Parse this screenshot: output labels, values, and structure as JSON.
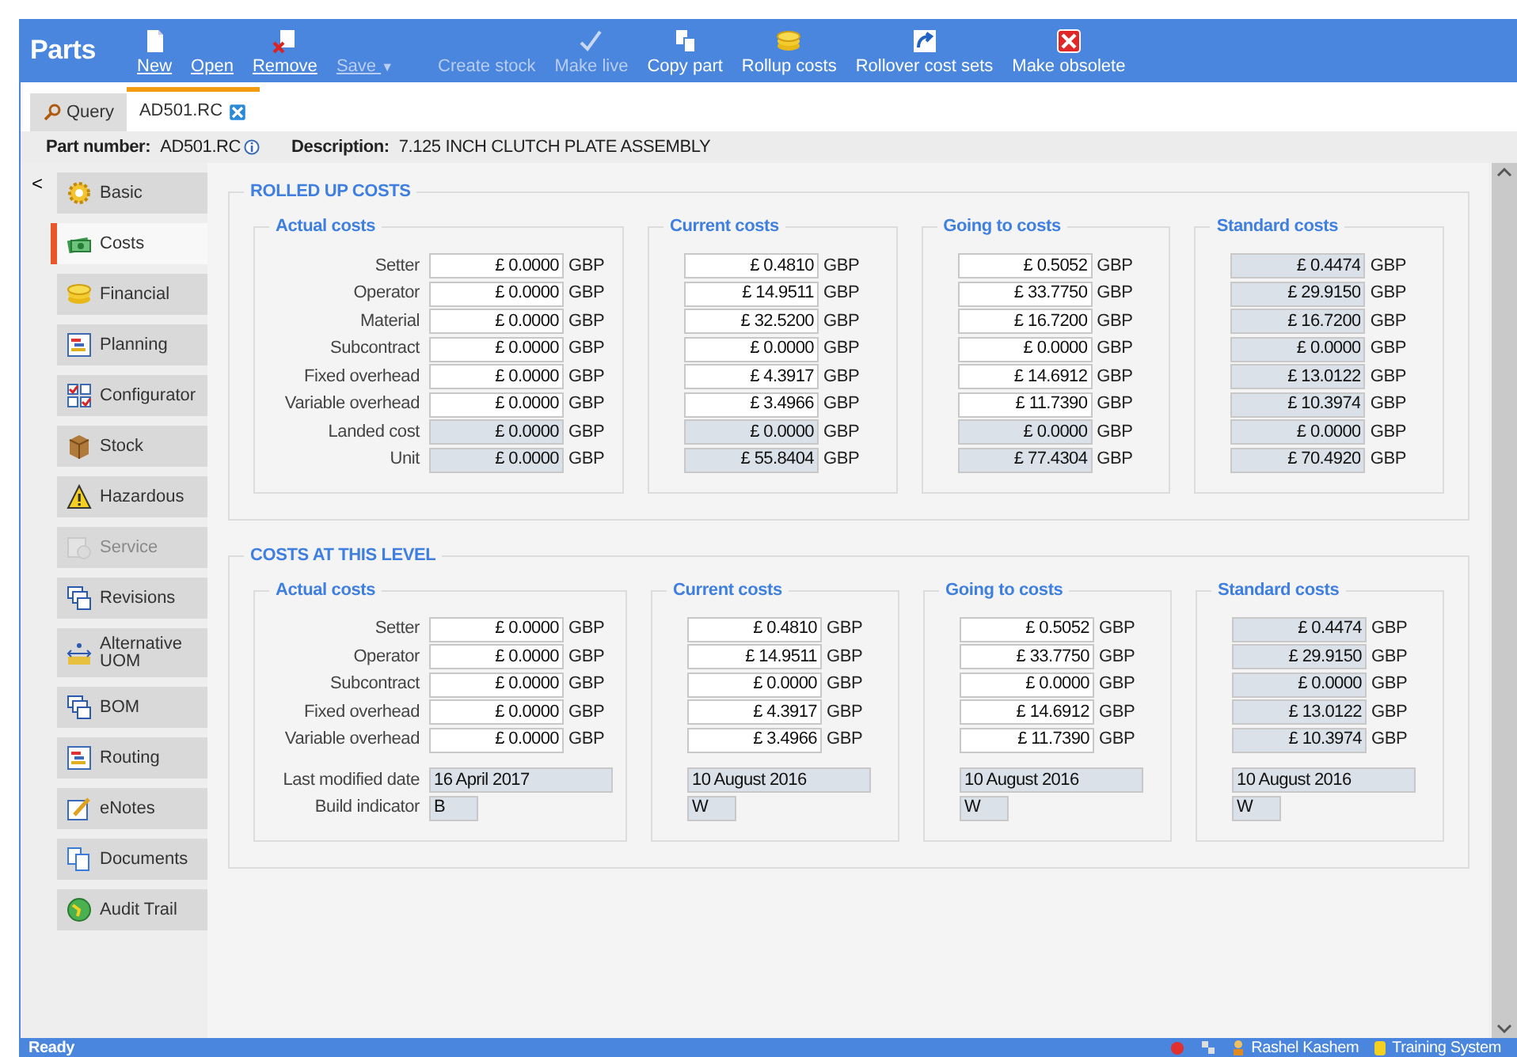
{
  "app": {
    "title": "Parts"
  },
  "toolbar": [
    {
      "label": "New",
      "disabled": false,
      "underlined": true
    },
    {
      "label": "Open",
      "disabled": false,
      "underlined": true
    },
    {
      "label": "Remove",
      "disabled": false,
      "underlined": true
    },
    {
      "label": "Save",
      "disabled": true,
      "underlined": true,
      "dropdown": "▼"
    },
    {
      "label": "Create stock",
      "disabled": true,
      "underlined": false
    },
    {
      "label": "Make live",
      "disabled": true,
      "underlined": false
    },
    {
      "label": "Copy part",
      "disabled": false,
      "underlined": false
    },
    {
      "label": "Rollup costs",
      "disabled": false,
      "underlined": false
    },
    {
      "label": "Rollover cost sets",
      "disabled": false,
      "underlined": false
    },
    {
      "label": "Make obsolete",
      "disabled": false,
      "underlined": false
    }
  ],
  "tabs": [
    {
      "label": "Query",
      "selected": false,
      "closable": false
    },
    {
      "label": "AD501.RC",
      "selected": true,
      "closable": true
    }
  ],
  "part": {
    "number_label": "Part number:",
    "number": "AD501.RC",
    "description_label": "Description:",
    "description": "7.125 INCH CLUTCH PLATE ASSEMBLY"
  },
  "sidebar": {
    "collapse": "<",
    "items": [
      {
        "label": "Basic",
        "selected": false,
        "disabled": false
      },
      {
        "label": "Costs",
        "selected": true,
        "disabled": false
      },
      {
        "label": "Financial",
        "selected": false,
        "disabled": false
      },
      {
        "label": "Planning",
        "selected": false,
        "disabled": false
      },
      {
        "label": "Configurator",
        "selected": false,
        "disabled": false
      },
      {
        "label": "Stock",
        "selected": false,
        "disabled": false
      },
      {
        "label": "Hazardous",
        "selected": false,
        "disabled": false
      },
      {
        "label": "Service",
        "selected": false,
        "disabled": true
      },
      {
        "label": "Revisions",
        "selected": false,
        "disabled": false
      },
      {
        "label": "Alternative UOM",
        "selected": false,
        "disabled": false
      },
      {
        "label": "BOM",
        "selected": false,
        "disabled": false
      },
      {
        "label": "Routing",
        "selected": false,
        "disabled": false
      },
      {
        "label": "eNotes",
        "selected": false,
        "disabled": false
      },
      {
        "label": "Documents",
        "selected": false,
        "disabled": false
      },
      {
        "label": "Audit Trail",
        "selected": false,
        "disabled": false
      }
    ]
  },
  "sections": [
    {
      "title": "ROLLED UP COSTS",
      "groups": [
        {
          "title": "Actual costs",
          "rows": [
            {
              "label": "Setter",
              "kind": "money",
              "value": "£ 0.0000",
              "unit": "GBP",
              "readonly": false
            },
            {
              "label": "Operator",
              "kind": "money",
              "value": "£ 0.0000",
              "unit": "GBP",
              "readonly": false
            },
            {
              "label": "Material",
              "kind": "money",
              "value": "£ 0.0000",
              "unit": "GBP",
              "readonly": false
            },
            {
              "label": "Subcontract",
              "kind": "money",
              "value": "£ 0.0000",
              "unit": "GBP",
              "readonly": false
            },
            {
              "label": "Fixed overhead",
              "kind": "money",
              "value": "£ 0.0000",
              "unit": "GBP",
              "readonly": false
            },
            {
              "label": "Variable overhead",
              "kind": "money",
              "value": "£ 0.0000",
              "unit": "GBP",
              "readonly": false
            },
            {
              "label": "Landed cost",
              "kind": "money",
              "value": "£ 0.0000",
              "unit": "GBP",
              "readonly": true
            },
            {
              "label": "Unit",
              "kind": "money",
              "value": "£ 0.0000",
              "unit": "GBP",
              "readonly": true
            }
          ]
        },
        {
          "title": "Current costs",
          "rows": [
            {
              "kind": "money",
              "value": "£ 0.4810",
              "unit": "GBP",
              "readonly": false
            },
            {
              "kind": "money",
              "value": "£ 14.9511",
              "unit": "GBP",
              "readonly": false
            },
            {
              "kind": "money",
              "value": "£ 32.5200",
              "unit": "GBP",
              "readonly": false
            },
            {
              "kind": "money",
              "value": "£ 0.0000",
              "unit": "GBP",
              "readonly": false
            },
            {
              "kind": "money",
              "value": "£ 4.3917",
              "unit": "GBP",
              "readonly": false
            },
            {
              "kind": "money",
              "value": "£ 3.4966",
              "unit": "GBP",
              "readonly": false
            },
            {
              "kind": "money",
              "value": "£ 0.0000",
              "unit": "GBP",
              "readonly": true
            },
            {
              "kind": "money",
              "value": "£ 55.8404",
              "unit": "GBP",
              "readonly": true
            }
          ]
        },
        {
          "title": "Going to costs",
          "rows": [
            {
              "kind": "money",
              "value": "£ 0.5052",
              "unit": "GBP",
              "readonly": false
            },
            {
              "kind": "money",
              "value": "£ 33.7750",
              "unit": "GBP",
              "readonly": false
            },
            {
              "kind": "money",
              "value": "£ 16.7200",
              "unit": "GBP",
              "readonly": false
            },
            {
              "kind": "money",
              "value": "£ 0.0000",
              "unit": "GBP",
              "readonly": false
            },
            {
              "kind": "money",
              "value": "£ 14.6912",
              "unit": "GBP",
              "readonly": false
            },
            {
              "kind": "money",
              "value": "£ 11.7390",
              "unit": "GBP",
              "readonly": false
            },
            {
              "kind": "money",
              "value": "£ 0.0000",
              "unit": "GBP",
              "readonly": true
            },
            {
              "kind": "money",
              "value": "£ 77.4304",
              "unit": "GBP",
              "readonly": true
            }
          ]
        },
        {
          "title": "Standard costs",
          "rows": [
            {
              "kind": "money",
              "value": "£ 0.4474",
              "unit": "GBP",
              "readonly": true
            },
            {
              "kind": "money",
              "value": "£ 29.9150",
              "unit": "GBP",
              "readonly": true
            },
            {
              "kind": "money",
              "value": "£ 16.7200",
              "unit": "GBP",
              "readonly": true
            },
            {
              "kind": "money",
              "value": "£ 0.0000",
              "unit": "GBP",
              "readonly": true
            },
            {
              "kind": "money",
              "value": "£ 13.0122",
              "unit": "GBP",
              "readonly": true
            },
            {
              "kind": "money",
              "value": "£ 10.3974",
              "unit": "GBP",
              "readonly": true
            },
            {
              "kind": "money",
              "value": "£ 0.0000",
              "unit": "GBP",
              "readonly": true
            },
            {
              "kind": "money",
              "value": "£ 70.4920",
              "unit": "GBP",
              "readonly": true
            }
          ]
        }
      ]
    },
    {
      "title": "COSTS AT THIS LEVEL",
      "groups": [
        {
          "title": "Actual costs",
          "rows": [
            {
              "label": "Setter",
              "kind": "money",
              "value": "£ 0.0000",
              "unit": "GBP",
              "readonly": false
            },
            {
              "label": "Operator",
              "kind": "money",
              "value": "£ 0.0000",
              "unit": "GBP",
              "readonly": false
            },
            {
              "label": "Subcontract",
              "kind": "money",
              "value": "£ 0.0000",
              "unit": "GBP",
              "readonly": false
            },
            {
              "label": "Fixed overhead",
              "kind": "money",
              "value": "£ 0.0000",
              "unit": "GBP",
              "readonly": false
            },
            {
              "label": "Variable overhead",
              "kind": "money",
              "value": "£ 0.0000",
              "unit": "GBP",
              "readonly": false
            },
            {
              "label": "Last modified date",
              "kind": "date",
              "value": "16 April 2017",
              "readonly": true
            },
            {
              "label": "Build indicator",
              "kind": "code",
              "value": "B",
              "readonly": true
            }
          ]
        },
        {
          "title": "Current costs",
          "rows": [
            {
              "kind": "money",
              "value": "£ 0.4810",
              "unit": "GBP",
              "readonly": false
            },
            {
              "kind": "money",
              "value": "£ 14.9511",
              "unit": "GBP",
              "readonly": false
            },
            {
              "kind": "money",
              "value": "£ 0.0000",
              "unit": "GBP",
              "readonly": false
            },
            {
              "kind": "money",
              "value": "£ 4.3917",
              "unit": "GBP",
              "readonly": false
            },
            {
              "kind": "money",
              "value": "£ 3.4966",
              "unit": "GBP",
              "readonly": false
            },
            {
              "kind": "date",
              "value": "10 August 2016",
              "readonly": true
            },
            {
              "kind": "code",
              "value": "W",
              "readonly": true
            }
          ]
        },
        {
          "title": "Going to costs",
          "rows": [
            {
              "kind": "money",
              "value": "£ 0.5052",
              "unit": "GBP",
              "readonly": false
            },
            {
              "kind": "money",
              "value": "£ 33.7750",
              "unit": "GBP",
              "readonly": false
            },
            {
              "kind": "money",
              "value": "£ 0.0000",
              "unit": "GBP",
              "readonly": false
            },
            {
              "kind": "money",
              "value": "£ 14.6912",
              "unit": "GBP",
              "readonly": false
            },
            {
              "kind": "money",
              "value": "£ 11.7390",
              "unit": "GBP",
              "readonly": false
            },
            {
              "kind": "date",
              "value": "10 August 2016",
              "readonly": true
            },
            {
              "kind": "code",
              "value": "W",
              "readonly": true
            }
          ]
        },
        {
          "title": "Standard costs",
          "rows": [
            {
              "kind": "money",
              "value": "£ 0.4474",
              "unit": "GBP",
              "readonly": true
            },
            {
              "kind": "money",
              "value": "£ 29.9150",
              "unit": "GBP",
              "readonly": true
            },
            {
              "kind": "money",
              "value": "£ 0.0000",
              "unit": "GBP",
              "readonly": true
            },
            {
              "kind": "money",
              "value": "£ 13.0122",
              "unit": "GBP",
              "readonly": true
            },
            {
              "kind": "money",
              "value": "£ 10.3974",
              "unit": "GBP",
              "readonly": true
            },
            {
              "kind": "date",
              "value": "10 August 2016",
              "readonly": true
            },
            {
              "kind": "code",
              "value": "W",
              "readonly": true
            }
          ]
        }
      ]
    }
  ],
  "status_bar": {
    "text": "Ready",
    "user": "Rashel Kashem",
    "system": "Training System"
  }
}
